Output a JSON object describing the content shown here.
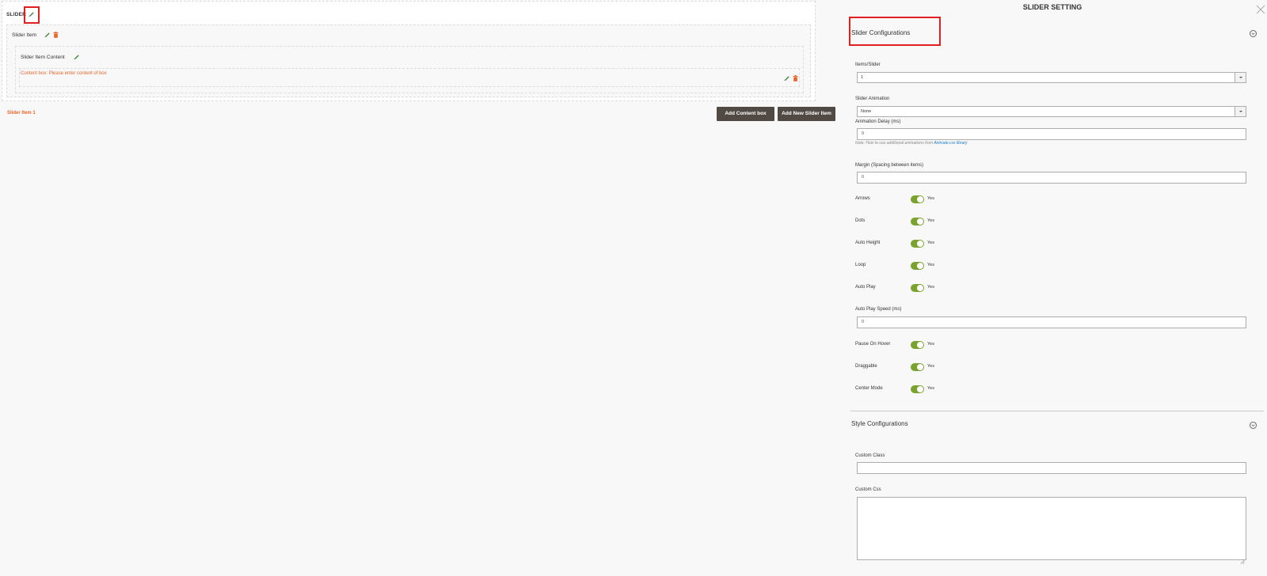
{
  "builder": {
    "slider_label": "SLIDER",
    "slider_item_label": "Slider Item",
    "slider_item_content_label": "Slider Item Content",
    "content_box_placeholder": "Content box: Please enter content of box",
    "slider_item_tab": "Slider Item 1",
    "add_content_box_label": "Add Content box",
    "add_new_slider_item_label": "Add New Slider Item"
  },
  "panel": {
    "title": "SLIDER SETTING",
    "close_icon": "close-icon",
    "slider_config": {
      "title": "Slider Configurations",
      "items_slider_label": "Items/Slider",
      "items_slider_value": "1",
      "slider_animation_label": "Slider Animation",
      "slider_animation_value": "None",
      "animation_delay_label": "Animation Delay (ms)",
      "animation_delay_value": "0",
      "note_prefix": "Note: How to use additional animations from ",
      "note_link": "Animate.css library",
      "margin_label": "Margin (Spacing between items)",
      "margin_value": "0",
      "arrows_label": "Arrows",
      "dots_label": "Dots",
      "auto_height_label": "Auto Height",
      "loop_label": "Loop",
      "auto_play_label": "Auto Play",
      "auto_play_speed_label": "Auto Play Speed (ms)",
      "auto_play_speed_value": "0",
      "pause_on_hover_label": "Pause On Hover",
      "draggable_label": "Draggable",
      "center_mode_label": "Center Mode",
      "yes_label": "Yes"
    },
    "style_config": {
      "title": "Style Configurations",
      "custom_class_label": "Custom Class",
      "custom_class_value": "",
      "custom_css_label": "Custom Css"
    }
  },
  "colors": {
    "toggle_on": "#79a22e",
    "button_bg": "#514943",
    "accent_orange": "#e8662a",
    "highlight_red": "#e02020"
  }
}
